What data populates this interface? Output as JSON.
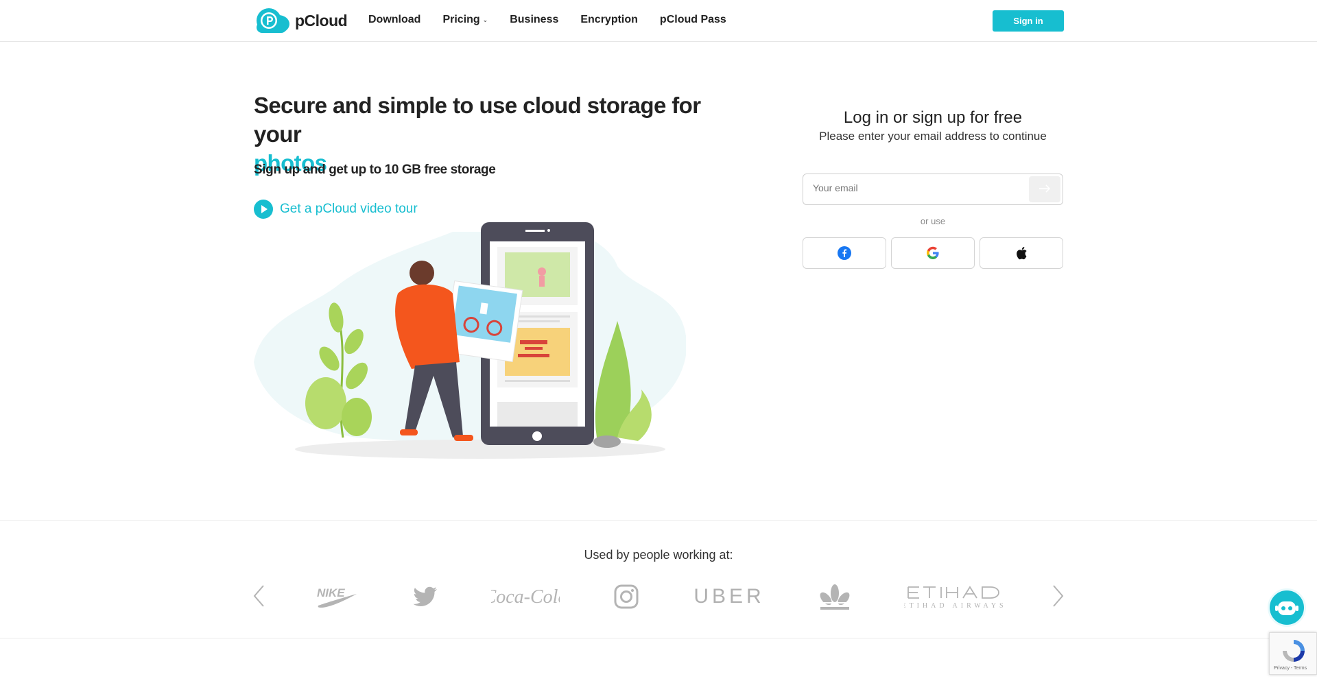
{
  "header": {
    "logo_text": "pCloud",
    "nav": [
      {
        "label": "Download"
      },
      {
        "label": "Pricing",
        "has_dropdown": true
      },
      {
        "label": "Business"
      },
      {
        "label": "Encryption"
      },
      {
        "label": "pCloud Pass"
      }
    ],
    "signin_label": "Sign in"
  },
  "hero": {
    "title": "Secure and simple to use cloud storage for your",
    "title_accent": "photos",
    "subtitle": "Sign up and get up to 10 GB free storage",
    "tour_label": "Get a pCloud video tour"
  },
  "login": {
    "title": "Log in or sign up for free",
    "subtitle": "Please enter your email address to continue",
    "email_placeholder": "Your email",
    "or_use": "or use",
    "providers": [
      "facebook-icon",
      "google-icon",
      "apple-icon"
    ]
  },
  "logos": {
    "heading": "Used by people working at:",
    "brands": [
      "NIKE",
      "Twitter",
      "Coca-Cola",
      "Instagram",
      "UBER",
      "adidas",
      "ETIHAD AIRWAYS"
    ]
  },
  "recaptcha": {
    "text": "Privacy - Terms"
  },
  "colors": {
    "accent": "#17bed0",
    "text": "#222222",
    "logo_gray": "#b4b4b4"
  }
}
